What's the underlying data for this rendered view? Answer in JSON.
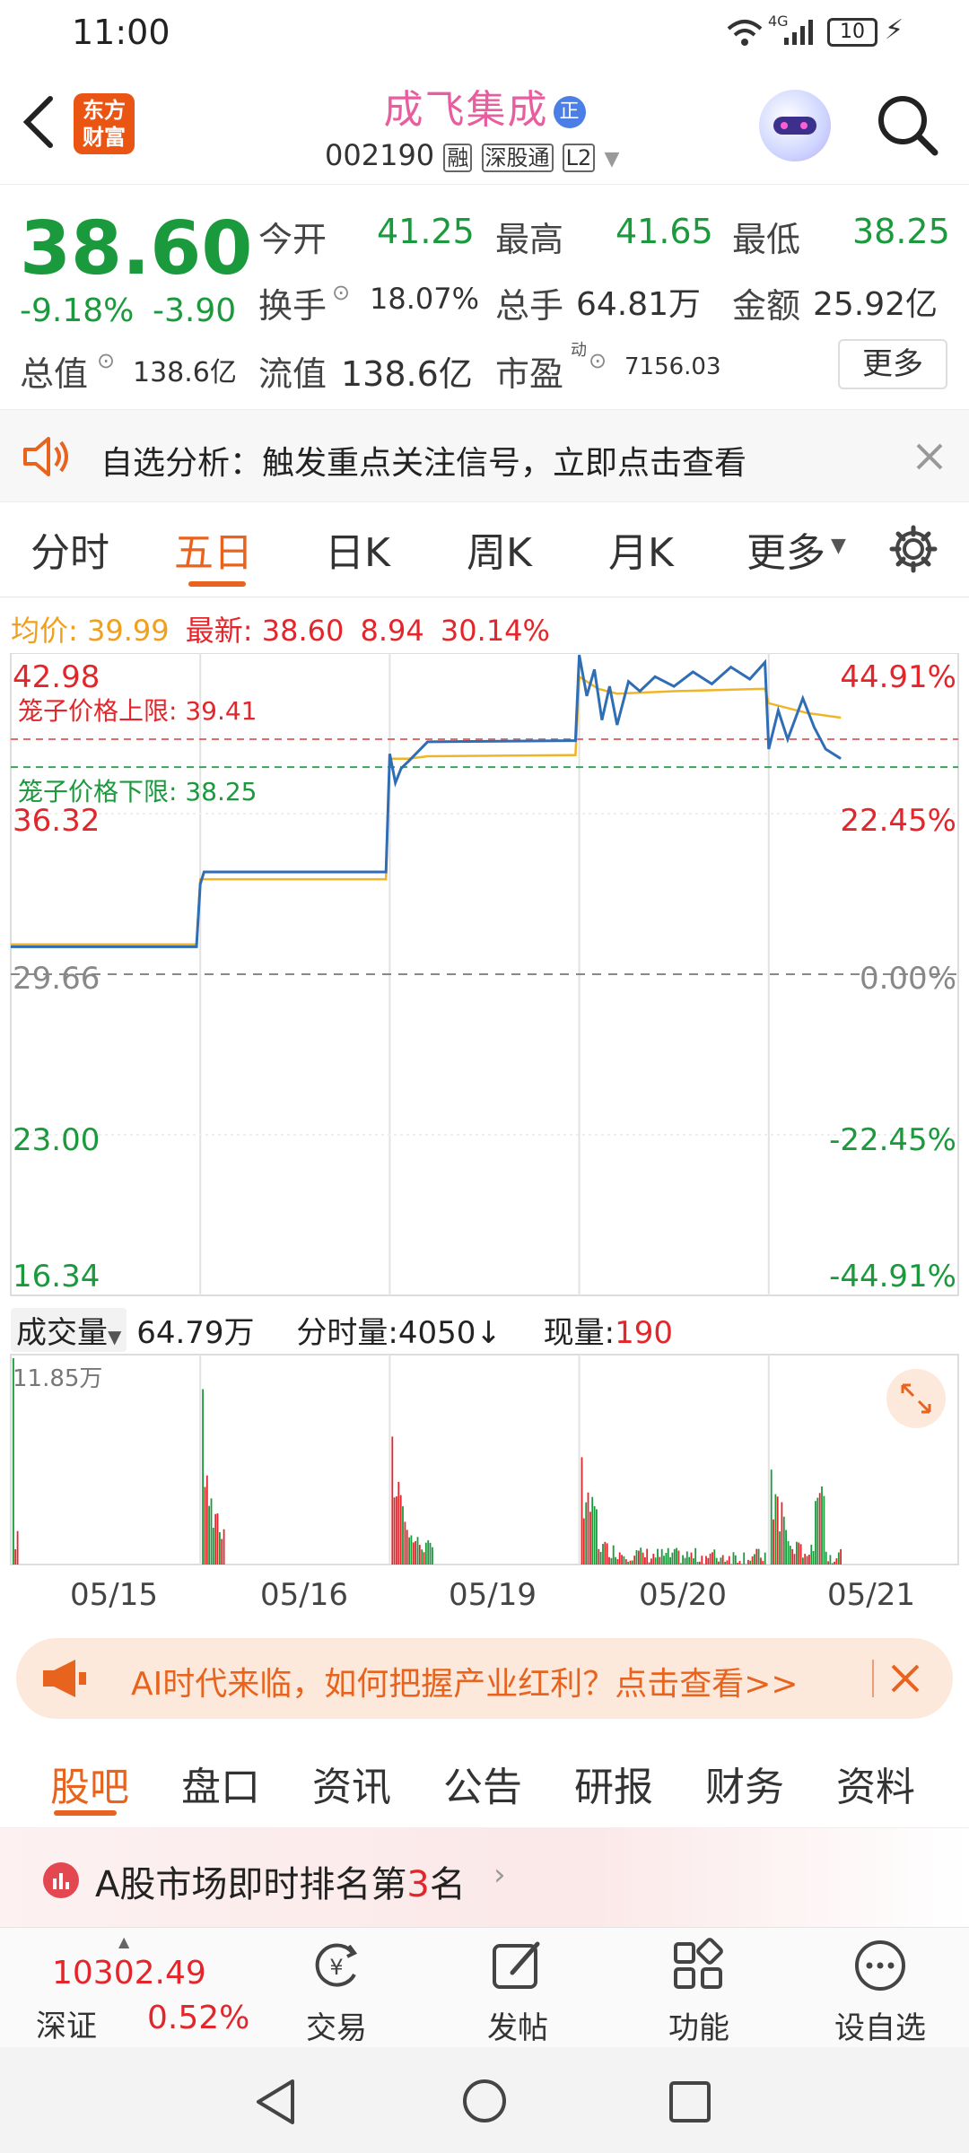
{
  "status": {
    "time": "11:00",
    "network": "4G",
    "battery": "10"
  },
  "header": {
    "logo_line1": "东方",
    "logo_line2": "财富",
    "stock_name": "成飞集成",
    "badge": "正",
    "code": "002190",
    "tag1": "融",
    "tag2": "深股通",
    "tag3": "L2"
  },
  "quote": {
    "price": "38.60",
    "change_pct": "-9.18%",
    "change": "-3.90",
    "open_label": "今开",
    "open": "41.25",
    "high_label": "最高",
    "high": "41.65",
    "low_label": "最低",
    "low": "38.25",
    "turnover_label": "换手",
    "turnover": "18.07%",
    "volume_label": "总手",
    "volume": "64.81万",
    "amount_label": "金额",
    "amount": "25.92亿",
    "mktcap_label": "总值",
    "mktcap": "138.6亿",
    "float_label": "流值",
    "float": "138.6亿",
    "pe_label": "市盈",
    "pe_sup": "动",
    "pe": "7156.03",
    "more": "更多"
  },
  "notice": {
    "text": "自选分析：触发重点关注信号，立即点击查看"
  },
  "tabs": [
    "分时",
    "五日",
    "日K",
    "周K",
    "月K",
    "更多"
  ],
  "chart_info": {
    "avg_label": "均价:",
    "avg": "39.99",
    "latest_label": "最新:",
    "latest": "38.60",
    "v1": "8.94",
    "v2": "30.14%"
  },
  "chart_data": {
    "type": "line",
    "x": [
      "05/15",
      "05/16",
      "05/19",
      "05/20",
      "05/21"
    ],
    "y_left_ticks": [
      "42.98",
      "36.32",
      "29.66",
      "23.00",
      "16.34"
    ],
    "y_right_ticks": [
      "44.91%",
      "22.45%",
      "0.00%",
      "-22.45%",
      "-44.91%"
    ],
    "ylim": [
      16.34,
      42.98
    ],
    "upper_label": "笼子价格上限:",
    "upper": "39.41",
    "lower_label": "笼子价格下限:",
    "lower": "38.25",
    "series": [
      {
        "name": "price",
        "values": [
          [
            0,
            30.8
          ],
          [
            0.98,
            30.8
          ],
          [
            1.0,
            33.4
          ],
          [
            1.02,
            33.9
          ],
          [
            1.98,
            33.9
          ],
          [
            2.0,
            38.8
          ],
          [
            2.03,
            37.6
          ],
          [
            2.06,
            38.2
          ],
          [
            2.1,
            38.5
          ],
          [
            2.2,
            39.3
          ],
          [
            2.98,
            39.35
          ],
          [
            3.0,
            42.9
          ],
          [
            3.04,
            41.2
          ],
          [
            3.08,
            42.3
          ],
          [
            3.12,
            40.2
          ],
          [
            3.16,
            41.6
          ],
          [
            3.2,
            40.0
          ],
          [
            3.26,
            41.8
          ],
          [
            3.32,
            41.4
          ],
          [
            3.4,
            42.0
          ],
          [
            3.5,
            41.6
          ],
          [
            3.6,
            42.2
          ],
          [
            3.7,
            41.7
          ],
          [
            3.8,
            42.4
          ],
          [
            3.9,
            41.9
          ],
          [
            3.98,
            42.6
          ],
          [
            4.0,
            39.0
          ],
          [
            4.05,
            40.6
          ],
          [
            4.1,
            39.4
          ],
          [
            4.18,
            41.1
          ],
          [
            4.24,
            39.9
          ],
          [
            4.3,
            39.0
          ],
          [
            4.38,
            38.6
          ]
        ]
      },
      {
        "name": "avg",
        "values": [
          [
            0,
            30.9
          ],
          [
            0.98,
            30.9
          ],
          [
            1.0,
            33.6
          ],
          [
            1.98,
            33.6
          ],
          [
            2.0,
            38.6
          ],
          [
            2.1,
            38.6
          ],
          [
            2.2,
            38.7
          ],
          [
            2.98,
            38.75
          ],
          [
            3.0,
            42.0
          ],
          [
            3.1,
            41.5
          ],
          [
            3.2,
            41.3
          ],
          [
            3.5,
            41.4
          ],
          [
            3.98,
            41.5
          ],
          [
            4.0,
            40.9
          ],
          [
            4.2,
            40.5
          ],
          [
            4.38,
            40.3
          ]
        ]
      }
    ]
  },
  "volume": {
    "label": "成交量",
    "total": "64.79万",
    "tick_label": "分时量:4050",
    "current_label": "现量:",
    "current": "190",
    "max": "11.85万"
  },
  "promo": {
    "text": "AI时代来临，如何把握产业红利？点击查看>>"
  },
  "sub_tabs": [
    "股吧",
    "盘口",
    "资讯",
    "公告",
    "研报",
    "财务",
    "资料"
  ],
  "rank": {
    "prefix": "A股市场即时排名第",
    "num": "3",
    "suffix": "名"
  },
  "index": {
    "value": "10302.49",
    "name": "深证",
    "pct": "0.52%"
  },
  "nav": [
    "交易",
    "发帖",
    "功能",
    "设自选"
  ]
}
